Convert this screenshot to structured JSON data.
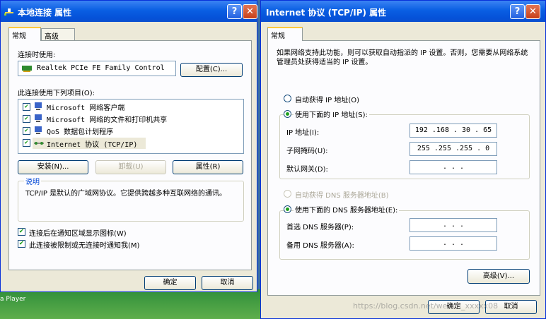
{
  "desktop": {
    "label": "a Player"
  },
  "left": {
    "title": "本地连接 属性",
    "tabs": [
      "常规",
      "高级"
    ],
    "connect_using_label": "连接时使用:",
    "adapter": "Realtek PCIe FE Family Control",
    "configure_btn": "配置(C)...",
    "items_label": "此连接使用下列项目(O):",
    "items": [
      {
        "label": "Microsoft 网络客户端",
        "checked": true
      },
      {
        "label": "Microsoft 网络的文件和打印机共享",
        "checked": true
      },
      {
        "label": "QoS 数据包计划程序",
        "checked": true
      },
      {
        "label": "Internet 协议 (TCP/IP)",
        "checked": true
      }
    ],
    "install_btn": "安装(N)...",
    "uninstall_btn": "卸载(U)",
    "properties_btn": "属性(R)",
    "desc_title": "说明",
    "desc_text": "TCP/IP 是默认的广域网协议。它提供跨越多种互联网络的通讯。",
    "show_icon_label": "连接后在通知区域显示图标(W)",
    "notify_label": "此连接被限制或无连接时通知我(M)",
    "ok_btn": "确定",
    "cancel_btn": "取消",
    "check_mark": "✔"
  },
  "right": {
    "title": "Internet 协议 (TCP/IP) 属性",
    "tab": "常规",
    "intro": "如果网络支持此功能，则可以获取自动指派的 IP 设置。否则，您需要从网络系统管理员处获得适当的 IP 设置。",
    "auto_ip": "自动获得 IP 地址(O)",
    "manual_ip": "使用下面的 IP 地址(S):",
    "ip_label": "IP 地址(I):",
    "ip_value": "192 .168 . 30 . 65",
    "mask_label": "子网掩码(U):",
    "mask_value": "255 .255 .255 . 0",
    "gateway_label": "默认网关(D):",
    "gateway_value": ". . .",
    "auto_dns": "自动获得 DNS 服务器地址(B)",
    "manual_dns": "使用下面的 DNS 服务器地址(E):",
    "pref_dns_label": "首选 DNS 服务器(P):",
    "pref_dns_value": ". . .",
    "alt_dns_label": "备用 DNS 服务器(A):",
    "alt_dns_value": ". . .",
    "advanced_btn": "高级(V)...",
    "ok_btn": "确定",
    "cancel_btn": "取消",
    "watermark": "https://blog.csdn.net/weixin_xxxxx08"
  },
  "title_buttons": {
    "help": "?",
    "close": "✕"
  },
  "colors": {
    "title_start": "#3b83f3",
    "title_end": "#0a4fcf",
    "dialog_bg": "#ece9d8",
    "check_green": "#21a121"
  }
}
